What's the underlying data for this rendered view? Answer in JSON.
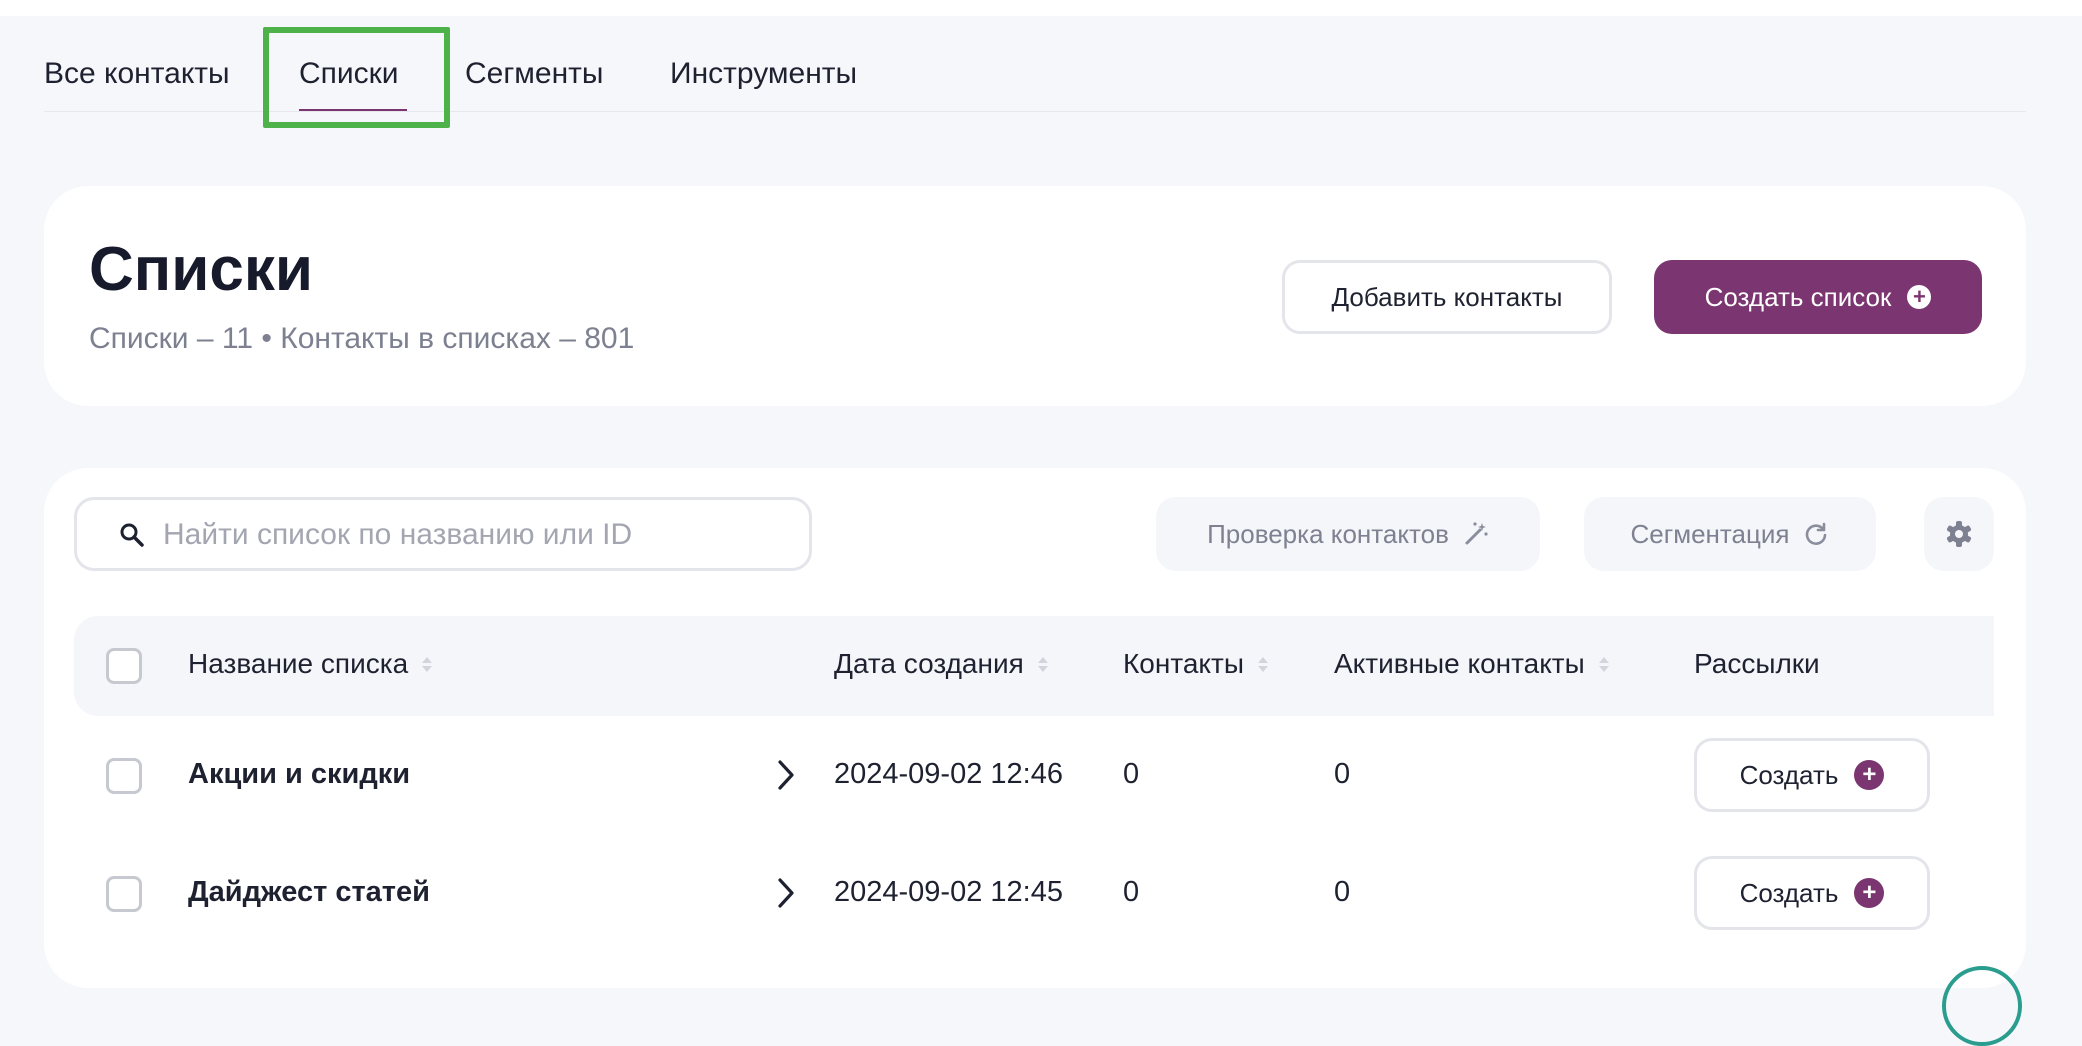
{
  "tabs": {
    "all_contacts": "Все контакты",
    "lists": "Списки",
    "segments": "Сегменты",
    "tools": "Инструменты",
    "active": "lists"
  },
  "header": {
    "title": "Списки",
    "subtitle": "Списки – 11 • Контакты в списках – 801",
    "add_contacts_label": "Добавить контакты",
    "create_list_label": "Создать список"
  },
  "toolbar": {
    "search_placeholder": "Найти список по названию или ID",
    "search_value": "",
    "check_contacts_label": "Проверка контактов",
    "segmentation_label": "Сегментация"
  },
  "table": {
    "columns": {
      "name": "Название списка",
      "created": "Дата создания",
      "contacts": "Контакты",
      "active_contacts": "Активные контакты",
      "mailings": "Рассылки"
    },
    "rows": [
      {
        "name": "Акции и скидки",
        "created": "2024-09-02 12:46",
        "contacts": "0",
        "active_contacts": "0",
        "action_label": "Создать"
      },
      {
        "name": "Дайджест статей",
        "created": "2024-09-02 12:45",
        "contacts": "0",
        "active_contacts": "0",
        "action_label": "Создать"
      }
    ]
  },
  "colors": {
    "accent": "#7b3570",
    "highlight": "#4cb249",
    "background": "#f6f7fb"
  },
  "icons": [
    "search-icon",
    "magic-wand-icon",
    "refresh-icon",
    "gear-icon",
    "chevron-right-icon",
    "plus-circle-icon"
  ]
}
